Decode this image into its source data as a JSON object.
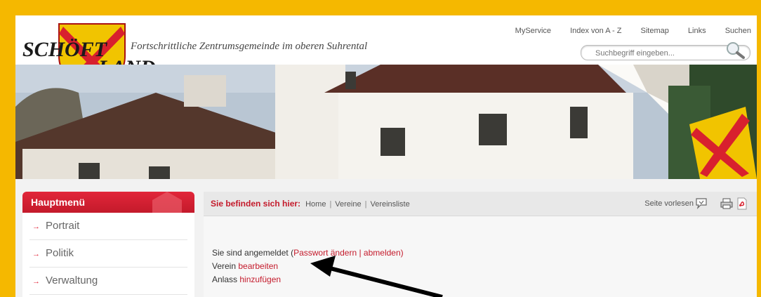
{
  "header": {
    "logo_line1": "SCHÖFT",
    "logo_line2": "LAND",
    "tagline": "Fortschrittliche Zentrumsgemeinde im oberen Suhrental"
  },
  "topnav": [
    "MyService",
    "Index von A - Z",
    "Sitemap",
    "Links",
    "Suchen"
  ],
  "search": {
    "placeholder": "Suchbegriff eingeben..."
  },
  "sidebar": {
    "title": "Hauptmenü",
    "items": [
      "Portrait",
      "Politik",
      "Verwaltung"
    ]
  },
  "breadcrumb": {
    "label": "Sie befinden sich hier:",
    "items": [
      "Home",
      "Vereine",
      "Vereinsliste"
    ],
    "read_aloud": "Seite vorlesen"
  },
  "main": {
    "logged_in_prefix": "Sie sind angemeldet (",
    "change_password": "Passwort ändern",
    "separator": " | ",
    "logout": "abmelden",
    "logged_in_suffix": ")",
    "club_prefix": "Verein ",
    "club_edit": "bearbeiten",
    "event_prefix": "Anlass ",
    "event_add": "hinzufügen"
  },
  "colors": {
    "frame": "#f5b800",
    "accent": "#c41a2b"
  }
}
